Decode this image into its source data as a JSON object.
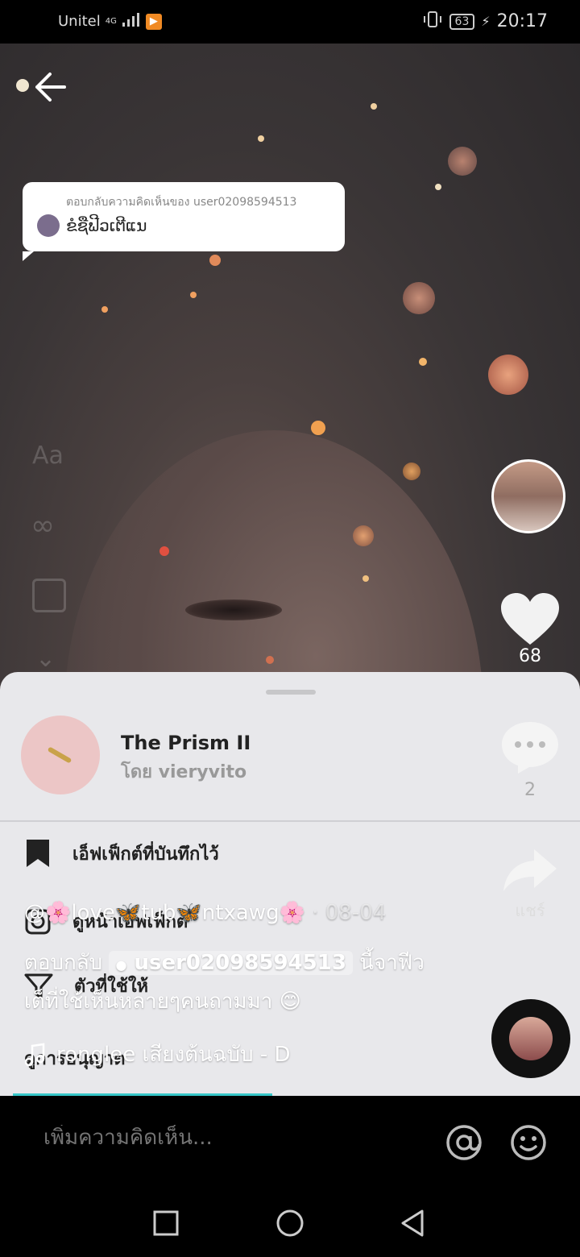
{
  "status_bar": {
    "carrier": "Unitel",
    "network_label": "4G",
    "battery": "63",
    "time": "20:17"
  },
  "reply_bubble": {
    "label": "ตอบกลับความคิดเห็นของ user02098594513",
    "text": "ຂໍຊືຟີວເຕີແນ"
  },
  "effect_sheet": {
    "effect_name": "The Prism II",
    "effect_author": "โดย vieryvito",
    "menu": [
      {
        "label": "เอ็ฟเฟ็กต์ที่บันทึกไว้",
        "icon": "bookmark-icon"
      },
      {
        "label": "ดูหน้าเอ็ฟเฟ็กต์",
        "icon": "effect-page-icon"
      },
      {
        "label": "ตัวที่ใช้ให้",
        "icon": "filter-icon"
      },
      {
        "label": "ดูการอนุญาต",
        "icon": ""
      }
    ]
  },
  "video_info": {
    "username": "@🌸love🦋tub🦋ntxawg🌸",
    "date": "· 08-04",
    "reply_prefix": "ตอบกลับ",
    "reply_user": "user02098594513",
    "reply_suffix": "นี้จาฟีว",
    "caption": "เต็ที่ใช้เห็นหลายๆคนถามมา 😊",
    "music": "ronglee    เสียงต้นฉบับ - D"
  },
  "right_rail": {
    "likes": "68",
    "comments": "2",
    "share_label": "แชร์"
  },
  "comment_bar": {
    "placeholder": "เพิ่มความคิดเห็น..."
  },
  "colors": {
    "sheet_bg": "#e8e8eb",
    "accent_progress": "#37c7c9"
  }
}
